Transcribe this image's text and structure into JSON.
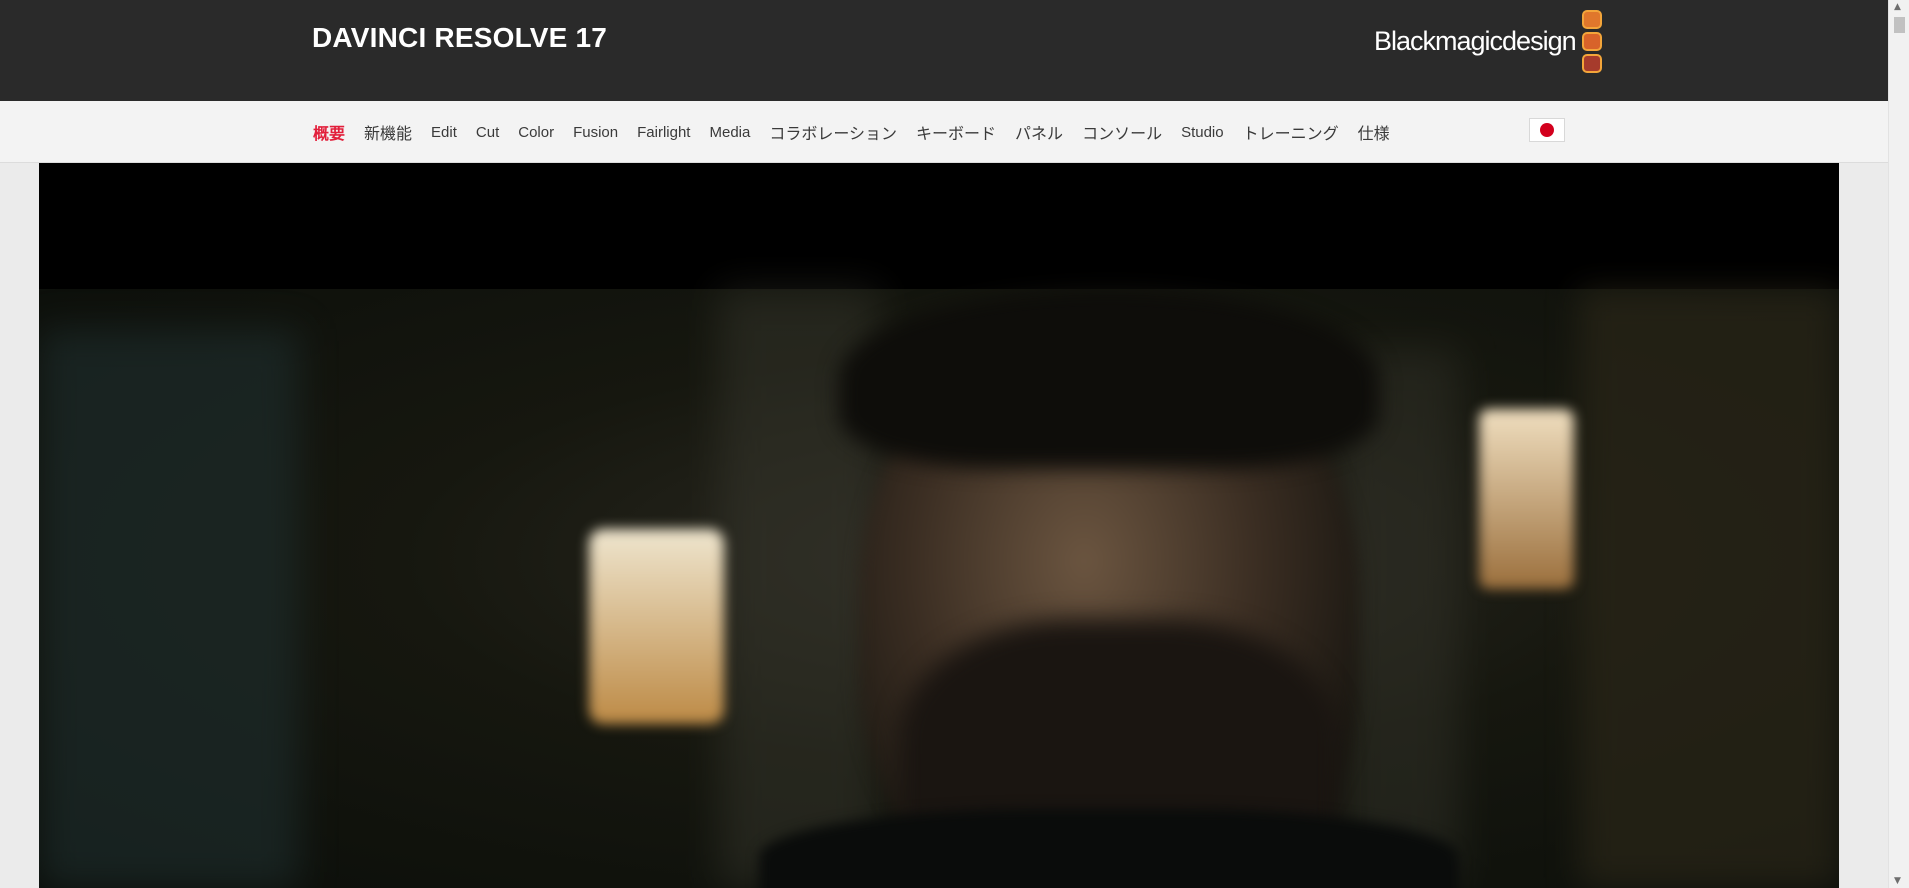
{
  "header": {
    "product_title": "DAVINCI RESOLVE 17",
    "brand_logo_text": "Blackmagicdesign",
    "brand_colors": [
      "#e0772c",
      "#d8632a",
      "#a63b2c"
    ]
  },
  "nav": {
    "items": [
      {
        "label": "概要",
        "active": true
      },
      {
        "label": "新機能"
      },
      {
        "label": "Edit"
      },
      {
        "label": "Cut"
      },
      {
        "label": "Color"
      },
      {
        "label": "Fusion"
      },
      {
        "label": "Fairlight"
      },
      {
        "label": "Media"
      },
      {
        "label": "コラボレーション"
      },
      {
        "label": "キーボード"
      },
      {
        "label": "パネル"
      },
      {
        "label": "コンソール"
      },
      {
        "label": "Studio"
      },
      {
        "label": "トレーニング"
      },
      {
        "label": "仕様"
      }
    ],
    "active_color": "#e21f3b",
    "language_flag": "japan-flag-icon"
  },
  "hero": {
    "media": "hero-video-frame"
  }
}
